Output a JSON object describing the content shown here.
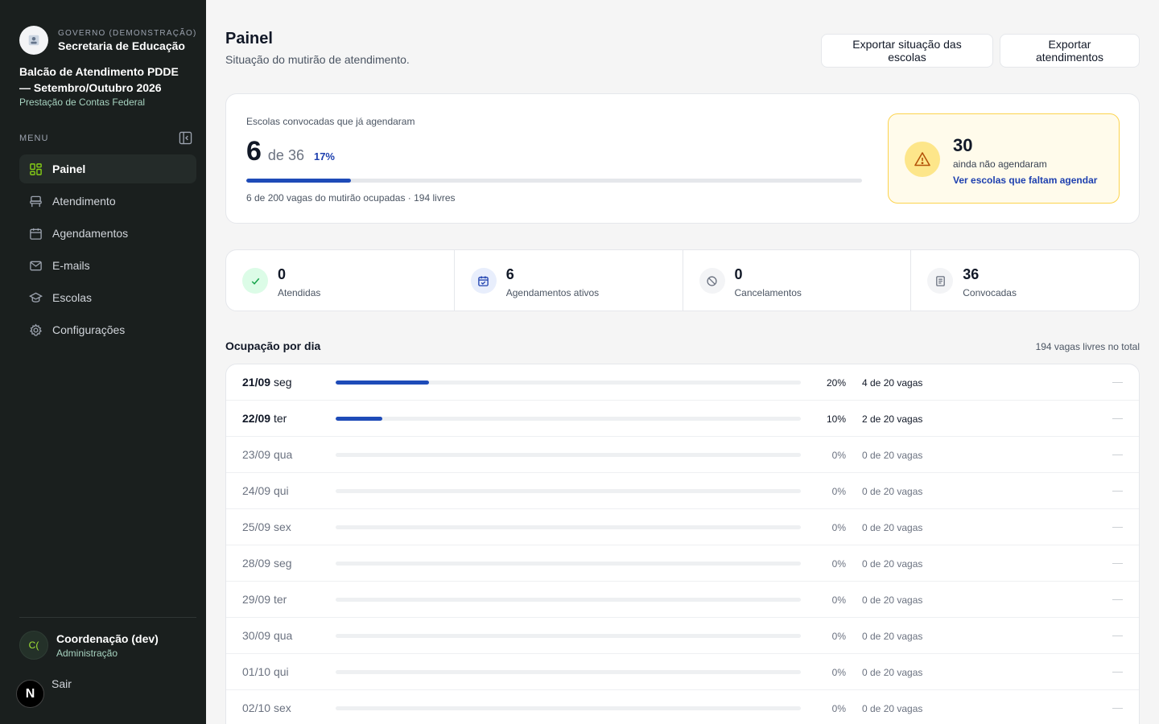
{
  "sidebar": {
    "gov_label": "GOVERNO (DEMONSTRAÇÃO)",
    "secretaria": "Secretaria de Educação",
    "title": "Balcão de Atendimento PDDE — Setembro/Outubro 2026",
    "subtitle": "Prestação de Contas Federal",
    "menu_label": "MENU",
    "items": [
      {
        "label": "Painel",
        "icon": "dashboard-icon",
        "active": true
      },
      {
        "label": "Atendimento",
        "icon": "desk-icon"
      },
      {
        "label": "Agendamentos",
        "icon": "calendar-icon"
      },
      {
        "label": "E-mails",
        "icon": "mail-icon"
      },
      {
        "label": "Escolas",
        "icon": "school-icon"
      },
      {
        "label": "Configurações",
        "icon": "gear-icon"
      }
    ],
    "user": {
      "initials": "C(",
      "name": "Coordenação (dev)",
      "role": "Administração"
    },
    "logout": "Sair",
    "dev_badge": "N"
  },
  "header": {
    "title": "Painel",
    "subtitle": "Situação do mutirão de atendimento.",
    "export_schools": "Exportar situação das escolas",
    "export_attendances": "Exportar atendimentos"
  },
  "progress": {
    "label": "Escolas convocadas que já agendaram",
    "count": "6",
    "total_text": "de 36",
    "percent_text": "17%",
    "percent": 17,
    "footer": "6 de 200 vagas do mutirão ocupadas · 194 livres"
  },
  "alert": {
    "count": "30",
    "text": "ainda não agendaram",
    "link": "Ver escolas que faltam agendar",
    "colors": {
      "bg": "#fffbeb",
      "border": "#fcd34d",
      "icon": "#b45309"
    }
  },
  "stats": [
    {
      "value": "0",
      "label": "Atendidas",
      "icon": "check-icon",
      "bg": "#dcfce7",
      "color": "#16a34a"
    },
    {
      "value": "6",
      "label": "Agendamentos ativos",
      "icon": "calendar-check-icon",
      "bg": "#e8eefc",
      "color": "#1e40af"
    },
    {
      "value": "0",
      "label": "Cancelamentos",
      "icon": "ban-icon",
      "bg": "#f3f4f6",
      "color": "#6b7280"
    },
    {
      "value": "36",
      "label": "Convocadas",
      "icon": "document-icon",
      "bg": "#f3f4f6",
      "color": "#6b7280"
    }
  ],
  "occupancy": {
    "title": "Ocupação por dia",
    "total_free": "194 vagas livres no total",
    "days": [
      {
        "date": "21/09",
        "weekday": "seg",
        "percent": 20,
        "percent_text": "20%",
        "vagas": "4 de 20 vagas",
        "extra": "—"
      },
      {
        "date": "22/09",
        "weekday": "ter",
        "percent": 10,
        "percent_text": "10%",
        "vagas": "2 de 20 vagas",
        "extra": "—"
      },
      {
        "date": "23/09",
        "weekday": "qua",
        "percent": 0,
        "percent_text": "0%",
        "vagas": "0 de 20 vagas",
        "extra": "—"
      },
      {
        "date": "24/09",
        "weekday": "qui",
        "percent": 0,
        "percent_text": "0%",
        "vagas": "0 de 20 vagas",
        "extra": "—"
      },
      {
        "date": "25/09",
        "weekday": "sex",
        "percent": 0,
        "percent_text": "0%",
        "vagas": "0 de 20 vagas",
        "extra": "—"
      },
      {
        "date": "28/09",
        "weekday": "seg",
        "percent": 0,
        "percent_text": "0%",
        "vagas": "0 de 20 vagas",
        "extra": "—"
      },
      {
        "date": "29/09",
        "weekday": "ter",
        "percent": 0,
        "percent_text": "0%",
        "vagas": "0 de 20 vagas",
        "extra": "—"
      },
      {
        "date": "30/09",
        "weekday": "qua",
        "percent": 0,
        "percent_text": "0%",
        "vagas": "0 de 20 vagas",
        "extra": "—"
      },
      {
        "date": "01/10",
        "weekday": "qui",
        "percent": 0,
        "percent_text": "0%",
        "vagas": "0 de 20 vagas",
        "extra": "—"
      },
      {
        "date": "02/10",
        "weekday": "sex",
        "percent": 0,
        "percent_text": "0%",
        "vagas": "0 de 20 vagas",
        "extra": "—"
      }
    ]
  },
  "colors": {
    "sidebar_bg": "#1a1f1e",
    "accent": "#1e4bb8",
    "active_icon": "#84cc16"
  }
}
